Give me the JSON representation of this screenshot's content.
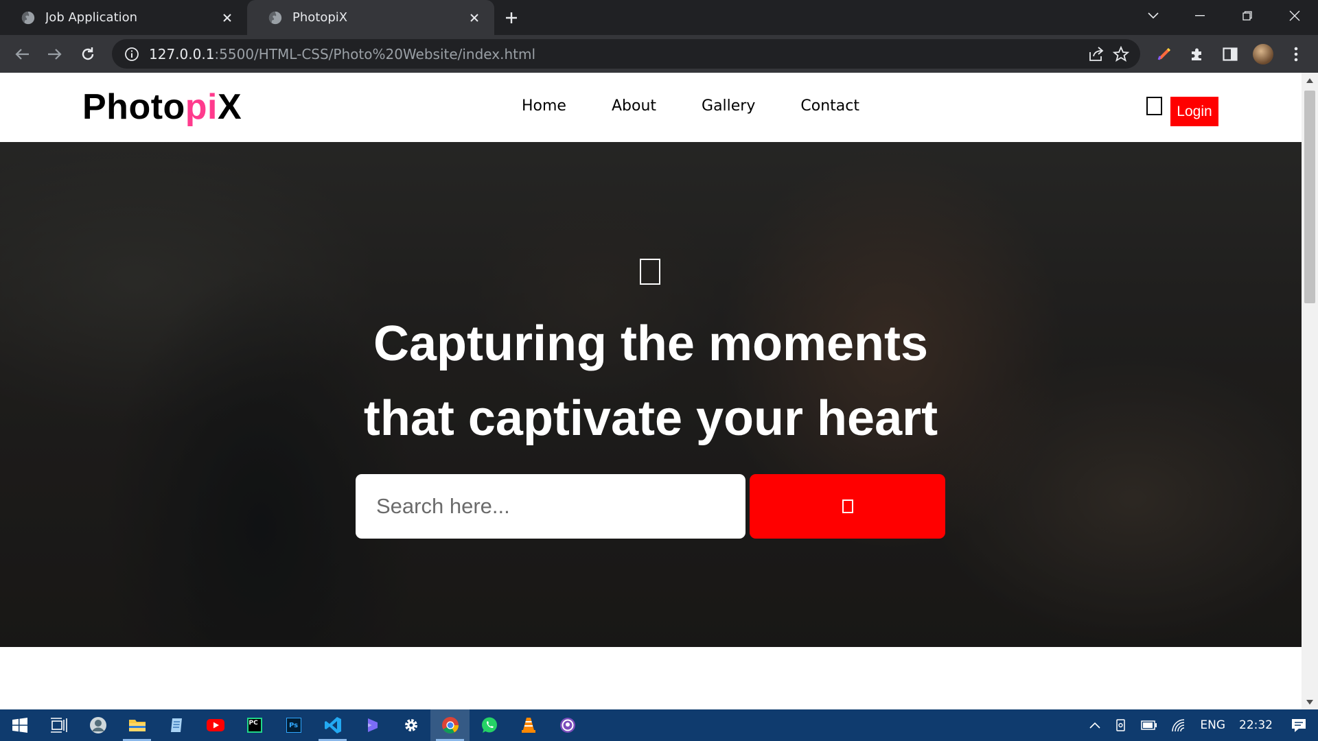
{
  "browser": {
    "tabs": [
      {
        "title": "Job Application",
        "active": false
      },
      {
        "title": "PhotopiX",
        "active": true
      }
    ],
    "url_host": "127.0.0.1",
    "url_rest": ":5500/HTML-CSS/Photo%20Website/index.html"
  },
  "site": {
    "logo_main": "Photo",
    "logo_accent": "pi",
    "logo_end": "X",
    "accent_color": "#ff3b8d",
    "nav": [
      "Home",
      "About",
      "Gallery",
      "Contact"
    ],
    "login_label": "Login"
  },
  "hero": {
    "title_line1": "Capturing the moments",
    "title_line2": "that captivate your heart",
    "search_placeholder": "Search here...",
    "search_button_color": "#ff0000"
  },
  "taskbar": {
    "language": "ENG",
    "time": "22:32"
  }
}
